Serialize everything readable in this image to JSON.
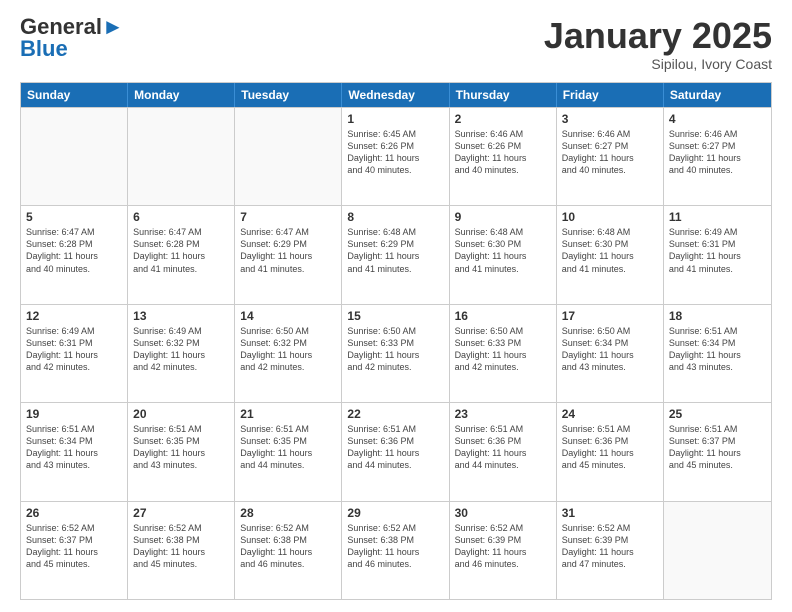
{
  "header": {
    "logo_general": "General",
    "logo_blue": "Blue",
    "month_title": "January 2025",
    "location": "Sipilou, Ivory Coast"
  },
  "weekdays": [
    "Sunday",
    "Monday",
    "Tuesday",
    "Wednesday",
    "Thursday",
    "Friday",
    "Saturday"
  ],
  "rows": [
    [
      {
        "day": "",
        "info": ""
      },
      {
        "day": "",
        "info": ""
      },
      {
        "day": "",
        "info": ""
      },
      {
        "day": "1",
        "info": "Sunrise: 6:45 AM\nSunset: 6:26 PM\nDaylight: 11 hours\nand 40 minutes."
      },
      {
        "day": "2",
        "info": "Sunrise: 6:46 AM\nSunset: 6:26 PM\nDaylight: 11 hours\nand 40 minutes."
      },
      {
        "day": "3",
        "info": "Sunrise: 6:46 AM\nSunset: 6:27 PM\nDaylight: 11 hours\nand 40 minutes."
      },
      {
        "day": "4",
        "info": "Sunrise: 6:46 AM\nSunset: 6:27 PM\nDaylight: 11 hours\nand 40 minutes."
      }
    ],
    [
      {
        "day": "5",
        "info": "Sunrise: 6:47 AM\nSunset: 6:28 PM\nDaylight: 11 hours\nand 40 minutes."
      },
      {
        "day": "6",
        "info": "Sunrise: 6:47 AM\nSunset: 6:28 PM\nDaylight: 11 hours\nand 41 minutes."
      },
      {
        "day": "7",
        "info": "Sunrise: 6:47 AM\nSunset: 6:29 PM\nDaylight: 11 hours\nand 41 minutes."
      },
      {
        "day": "8",
        "info": "Sunrise: 6:48 AM\nSunset: 6:29 PM\nDaylight: 11 hours\nand 41 minutes."
      },
      {
        "day": "9",
        "info": "Sunrise: 6:48 AM\nSunset: 6:30 PM\nDaylight: 11 hours\nand 41 minutes."
      },
      {
        "day": "10",
        "info": "Sunrise: 6:48 AM\nSunset: 6:30 PM\nDaylight: 11 hours\nand 41 minutes."
      },
      {
        "day": "11",
        "info": "Sunrise: 6:49 AM\nSunset: 6:31 PM\nDaylight: 11 hours\nand 41 minutes."
      }
    ],
    [
      {
        "day": "12",
        "info": "Sunrise: 6:49 AM\nSunset: 6:31 PM\nDaylight: 11 hours\nand 42 minutes."
      },
      {
        "day": "13",
        "info": "Sunrise: 6:49 AM\nSunset: 6:32 PM\nDaylight: 11 hours\nand 42 minutes."
      },
      {
        "day": "14",
        "info": "Sunrise: 6:50 AM\nSunset: 6:32 PM\nDaylight: 11 hours\nand 42 minutes."
      },
      {
        "day": "15",
        "info": "Sunrise: 6:50 AM\nSunset: 6:33 PM\nDaylight: 11 hours\nand 42 minutes."
      },
      {
        "day": "16",
        "info": "Sunrise: 6:50 AM\nSunset: 6:33 PM\nDaylight: 11 hours\nand 42 minutes."
      },
      {
        "day": "17",
        "info": "Sunrise: 6:50 AM\nSunset: 6:34 PM\nDaylight: 11 hours\nand 43 minutes."
      },
      {
        "day": "18",
        "info": "Sunrise: 6:51 AM\nSunset: 6:34 PM\nDaylight: 11 hours\nand 43 minutes."
      }
    ],
    [
      {
        "day": "19",
        "info": "Sunrise: 6:51 AM\nSunset: 6:34 PM\nDaylight: 11 hours\nand 43 minutes."
      },
      {
        "day": "20",
        "info": "Sunrise: 6:51 AM\nSunset: 6:35 PM\nDaylight: 11 hours\nand 43 minutes."
      },
      {
        "day": "21",
        "info": "Sunrise: 6:51 AM\nSunset: 6:35 PM\nDaylight: 11 hours\nand 44 minutes."
      },
      {
        "day": "22",
        "info": "Sunrise: 6:51 AM\nSunset: 6:36 PM\nDaylight: 11 hours\nand 44 minutes."
      },
      {
        "day": "23",
        "info": "Sunrise: 6:51 AM\nSunset: 6:36 PM\nDaylight: 11 hours\nand 44 minutes."
      },
      {
        "day": "24",
        "info": "Sunrise: 6:51 AM\nSunset: 6:36 PM\nDaylight: 11 hours\nand 45 minutes."
      },
      {
        "day": "25",
        "info": "Sunrise: 6:51 AM\nSunset: 6:37 PM\nDaylight: 11 hours\nand 45 minutes."
      }
    ],
    [
      {
        "day": "26",
        "info": "Sunrise: 6:52 AM\nSunset: 6:37 PM\nDaylight: 11 hours\nand 45 minutes."
      },
      {
        "day": "27",
        "info": "Sunrise: 6:52 AM\nSunset: 6:38 PM\nDaylight: 11 hours\nand 45 minutes."
      },
      {
        "day": "28",
        "info": "Sunrise: 6:52 AM\nSunset: 6:38 PM\nDaylight: 11 hours\nand 46 minutes."
      },
      {
        "day": "29",
        "info": "Sunrise: 6:52 AM\nSunset: 6:38 PM\nDaylight: 11 hours\nand 46 minutes."
      },
      {
        "day": "30",
        "info": "Sunrise: 6:52 AM\nSunset: 6:39 PM\nDaylight: 11 hours\nand 46 minutes."
      },
      {
        "day": "31",
        "info": "Sunrise: 6:52 AM\nSunset: 6:39 PM\nDaylight: 11 hours\nand 47 minutes."
      },
      {
        "day": "",
        "info": ""
      }
    ]
  ]
}
